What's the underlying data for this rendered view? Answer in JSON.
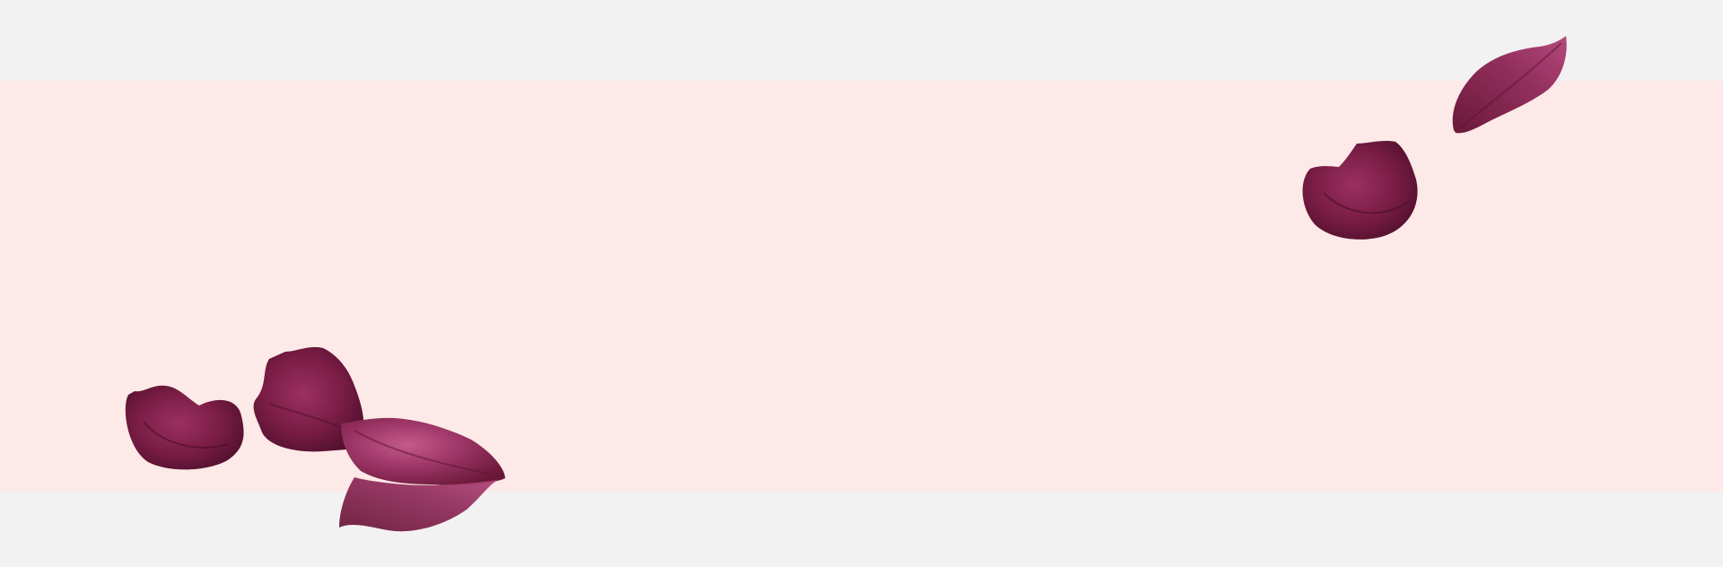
{
  "scene": {
    "background_color": "#f2f2f2",
    "band_color": "#fde9e7",
    "petal_colors": {
      "dark": "#5a1230",
      "mid": "#8a2550",
      "light": "#b04577"
    },
    "decorations": [
      "rose-petal-icon",
      "rose-petal-icon",
      "rose-petal-icon",
      "rose-petal-icon",
      "rose-petal-icon",
      "rose-petal-icon"
    ]
  }
}
